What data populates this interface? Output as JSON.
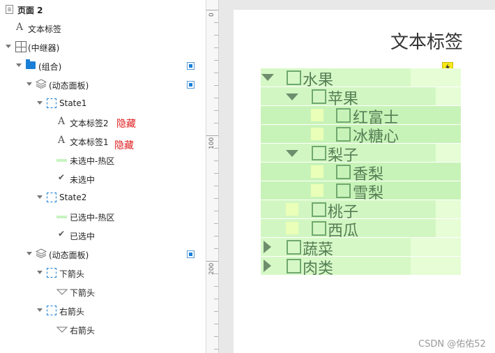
{
  "outline": {
    "items": [
      {
        "label": "页面 2",
        "icon": "page-icon"
      },
      {
        "label": "文本标签",
        "icon": "text-label-icon"
      },
      {
        "label": "(中继器)",
        "icon": "repeater-icon"
      },
      {
        "label": "(组合)",
        "icon": "folder-icon"
      },
      {
        "label": "(动态面板)",
        "icon": "layers-icon"
      },
      {
        "label": "State1",
        "icon": "state-icon"
      },
      {
        "label": "文本标签2",
        "icon": "text-label-icon"
      },
      {
        "label": "文本标签1",
        "icon": "text-label-icon"
      },
      {
        "label": "未选中-热区",
        "icon": "hotspot-icon"
      },
      {
        "label": "未选中",
        "icon": "check-icon"
      },
      {
        "label": "State2",
        "icon": "state-icon"
      },
      {
        "label": "已选中-热区",
        "icon": "hotspot-icon"
      },
      {
        "label": "已选中",
        "icon": "check-icon"
      },
      {
        "label": "(动态面板)",
        "icon": "layers-icon"
      },
      {
        "label": "下箭头",
        "icon": "state-icon"
      },
      {
        "label": "下箭头",
        "icon": "triangle-icon"
      },
      {
        "label": "右箭头",
        "icon": "state-icon"
      },
      {
        "label": "右箭头",
        "icon": "triangle-icon"
      }
    ],
    "notes": {
      "hidden_1": "隐藏",
      "hidden_2": "隐藏"
    }
  },
  "ruler": {
    "labels": [
      "0",
      "100",
      "200"
    ]
  },
  "canvas": {
    "title": "文本标签",
    "tree": [
      {
        "label": "水果"
      },
      {
        "label": "苹果"
      },
      {
        "label": "红富士"
      },
      {
        "label": "冰糖心"
      },
      {
        "label": "梨子"
      },
      {
        "label": "香梨"
      },
      {
        "label": "雪梨"
      },
      {
        "label": "桃子"
      },
      {
        "label": "西瓜"
      },
      {
        "label": "蔬菜"
      },
      {
        "label": "肉类"
      }
    ],
    "watermark": "CSDN @佑佑52"
  },
  "colors": {
    "cell_light": "#e3fdd0",
    "cell_mid": "#d2f8c2",
    "cell_dark": "#c5f2b6",
    "accent_blue": "#1a7fd6",
    "note_red": "#e02020"
  }
}
